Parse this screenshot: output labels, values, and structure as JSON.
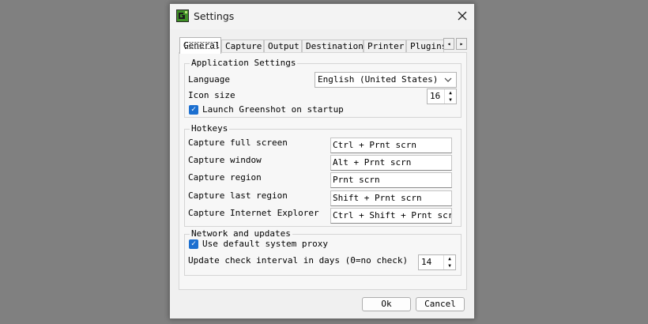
{
  "window": {
    "title": "Settings"
  },
  "tabs": [
    "General",
    "Capture",
    "Output",
    "Destination",
    "Printer",
    "Plugins"
  ],
  "tab_scroll": {
    "left": "◂",
    "right": "▸"
  },
  "application_settings": {
    "title": "Application Settings",
    "language_label": "Language",
    "language_value": "English (United States)",
    "icon_size_label": "Icon size",
    "icon_size_value": "16",
    "launch_label": "Launch Greenshot on startup",
    "launch_checked": true
  },
  "hotkeys": {
    "title": "Hotkeys",
    "items": [
      {
        "label": "Capture full screen",
        "value": "Ctrl + Prnt scrn"
      },
      {
        "label": "Capture window",
        "value": "Alt + Prnt scrn"
      },
      {
        "label": "Capture region",
        "value": "Prnt scrn"
      },
      {
        "label": "Capture last region",
        "value": "Shift + Prnt scrn"
      },
      {
        "label": "Capture Internet Explorer",
        "value": "Ctrl + Shift + Prnt scrn"
      }
    ]
  },
  "network": {
    "title": "Network and updates",
    "proxy_label": "Use default system proxy",
    "proxy_checked": true,
    "interval_label": "Update check interval in days (0=no check)",
    "interval_value": "14"
  },
  "buttons": {
    "ok": "Ok",
    "cancel": "Cancel"
  },
  "colors": {
    "checkbox": "#1c6fd0",
    "overlay": "#808080",
    "app_icon": "#3f8f26"
  },
  "icons": {
    "app": "greenshot-icon",
    "close": "close-icon",
    "combo": "chevron-down-icon",
    "check": "✓",
    "spin_up": "▲",
    "spin_down": "▼"
  }
}
